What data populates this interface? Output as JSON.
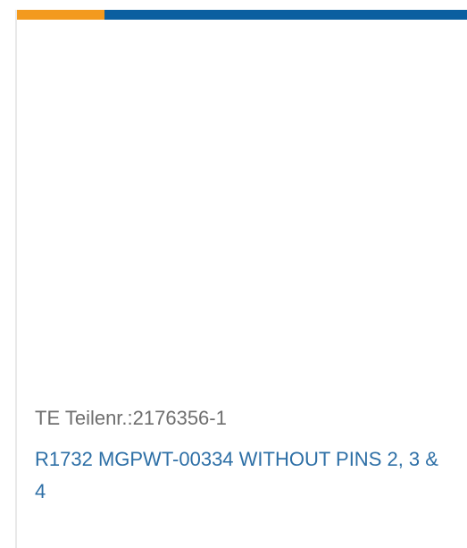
{
  "colors": {
    "accent_orange": "#f39a1e",
    "accent_blue": "#0b5fa0",
    "part_number_text": "#6e6e6e",
    "title_link": "#2d6fa6",
    "card_border": "#e9e9e9"
  },
  "product": {
    "part_number": "TE Teilenr.:2176356-1",
    "title": "R1732 MGPWT-00334 WITHOUT PINS 2, 3 & 4"
  }
}
